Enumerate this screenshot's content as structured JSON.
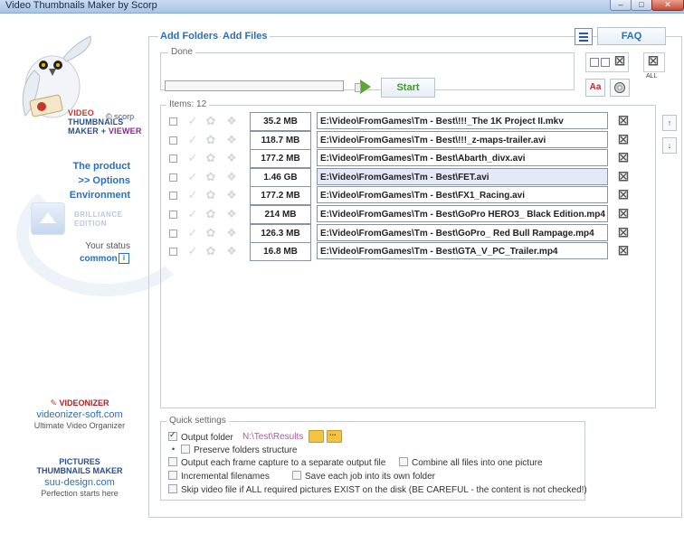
{
  "window": {
    "title": "Video Thumbnails Maker by Scorp"
  },
  "sidebar": {
    "logo_credit": "© scorp",
    "brand": {
      "line1": "VIDEO",
      "line2": "THUMBNAILS",
      "line3_a": "MAKER + ",
      "line3_b": "VIEWER"
    },
    "nav": {
      "product": "The product",
      "options": ">> Options",
      "environment": "Environment"
    },
    "edition": {
      "line1": "BRILLIANCE",
      "line2": "EDITION"
    },
    "status_label": "Your status",
    "status_value": "common",
    "info_icon": "i",
    "promo1": {
      "title": "VIDEONIZER",
      "url": "videonizer-soft.com",
      "subtitle": "Ultimate Video Organizer"
    },
    "promo2": {
      "title1": "PICTURES",
      "title2": "THUMBNAILS MAKER",
      "url": "suu-design.com",
      "subtitle": "Perfection starts here"
    }
  },
  "toolbar": {
    "add_folders": "Add Folders",
    "add_files": "Add Files",
    "faq": "FAQ",
    "all_label": "ALL"
  },
  "progress": {
    "label": "Done",
    "fraction": 0.0,
    "start_label": "Start"
  },
  "items": {
    "label": "Items: 12",
    "rows": [
      {
        "size": "35.2 MB",
        "path": "E:\\Video\\FromGames\\Tm - Best\\!!!_The 1K Project II.mkv",
        "selected": false
      },
      {
        "size": "118.7 MB",
        "path": "E:\\Video\\FromGames\\Tm - Best\\!!!_z-maps-trailer.avi",
        "selected": false
      },
      {
        "size": "177.2 MB",
        "path": "E:\\Video\\FromGames\\Tm - Best\\Abarth_divx.avi",
        "selected": false
      },
      {
        "size": "1.46 GB",
        "path": "E:\\Video\\FromGames\\Tm - Best\\FET.avi",
        "selected": true
      },
      {
        "size": "177.2 MB",
        "path": "E:\\Video\\FromGames\\Tm - Best\\FX1_Racing.avi",
        "selected": false
      },
      {
        "size": "214 MB",
        "path": "E:\\Video\\FromGames\\Tm - Best\\GoPro HERO3_ Black Edition.mp4",
        "selected": false
      },
      {
        "size": "126.3 MB",
        "path": "E:\\Video\\FromGames\\Tm - Best\\GoPro_ Red Bull Rampage.mp4",
        "selected": false
      },
      {
        "size": "16.8 MB",
        "path": "E:\\Video\\FromGames\\Tm - Best\\GTA_V_PC_Trailer.mp4",
        "selected": false
      }
    ]
  },
  "quick_settings": {
    "label": "Quick settings",
    "output_folder": {
      "label": "Output folder",
      "checked": true,
      "path": "N:\\Test\\Results"
    },
    "preserve_structure": {
      "label": "Preserve folders structure",
      "checked": false
    },
    "separate_output": {
      "label": "Output each frame capture to a separate output file",
      "checked": false
    },
    "combine_all": {
      "label": "Combine all files into one picture",
      "checked": false
    },
    "incremental": {
      "label": "Incremental filenames",
      "checked": false
    },
    "own_folder": {
      "label": "Save each job into its own folder",
      "checked": false
    },
    "skip_existing": {
      "label": "Skip video file if ALL required pictures EXIST on the disk (BE CAREFUL - the content is not checked!)",
      "checked": false
    }
  },
  "colors": {
    "accent": "#2a6fb8",
    "start_green": "#3a9a2a",
    "path_purple": "#b05aa0"
  }
}
